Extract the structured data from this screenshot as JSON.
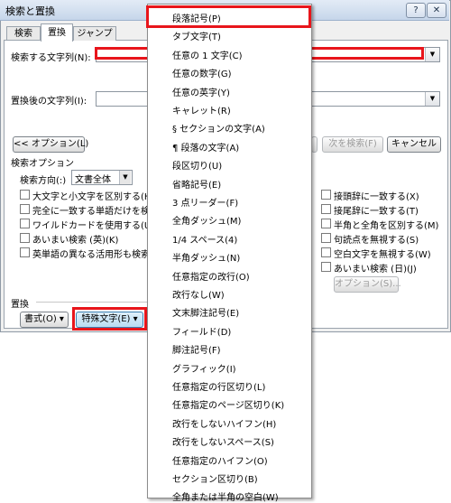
{
  "window": {
    "title": "検索と置換",
    "help_glyph": "?",
    "close_glyph": "✕",
    "tabs": [
      "検索",
      "置換",
      "ジャンプ"
    ]
  },
  "search": {
    "label": "検索する文字列(N):",
    "value": "",
    "replace_label": "置換後の文字列(I):",
    "replace_value": ""
  },
  "buttons": {
    "options": "<< オプション(L)",
    "find_next": "次を検索(F)",
    "cancel": "キャンセル",
    "options_small": "オプション(S)...",
    "format": "書式(O)",
    "special": "特殊文字(E)"
  },
  "options_group": {
    "title": "検索オプション",
    "direction_label": "検索方向(:)",
    "direction_value": "文書全体",
    "left_checks": [
      "大文字と小文字を区別する(H",
      "完全に一致する単語だけを検索",
      "ワイルドカードを使用する(U)",
      "あいまい検索 (英)(K)",
      "英単語の異なる活用形も検索"
    ],
    "right_checks": [
      "接頭辞に一致する(X)",
      "接尾辞に一致する(T)",
      "半角と全角を区別する(M)",
      "句読点を無視する(S)",
      "空白文字を無視する(W)",
      "あいまい検索 (日)(J)"
    ]
  },
  "replace_group": {
    "title": "置換"
  },
  "menu": {
    "items": [
      "段落記号(P)",
      "タブ文字(T)",
      "任意の 1 文字(C)",
      "任意の数字(G)",
      "任意の英字(Y)",
      "キャレット(R)",
      "§ セクションの文字(A)",
      "¶ 段落の文字(A)",
      "段区切り(U)",
      "省略記号(E)",
      "3 点リーダー(F)",
      "全角ダッシュ(M)",
      "1/4 スペース(4)",
      "半角ダッシュ(N)",
      "任意指定の改行(O)",
      "改行なし(W)",
      "文末脚注記号(E)",
      "フィールド(D)",
      "脚注記号(F)",
      "グラフィック(I)",
      "任意指定の行区切り(L)",
      "任意指定のページ区切り(K)",
      "改行をしないハイフン(H)",
      "改行をしないスペース(S)",
      "任意指定のハイフン(O)",
      "セクション区切り(B)",
      "全角または半角の空白(W)"
    ]
  },
  "colors": {
    "highlight": "#e8151b"
  }
}
